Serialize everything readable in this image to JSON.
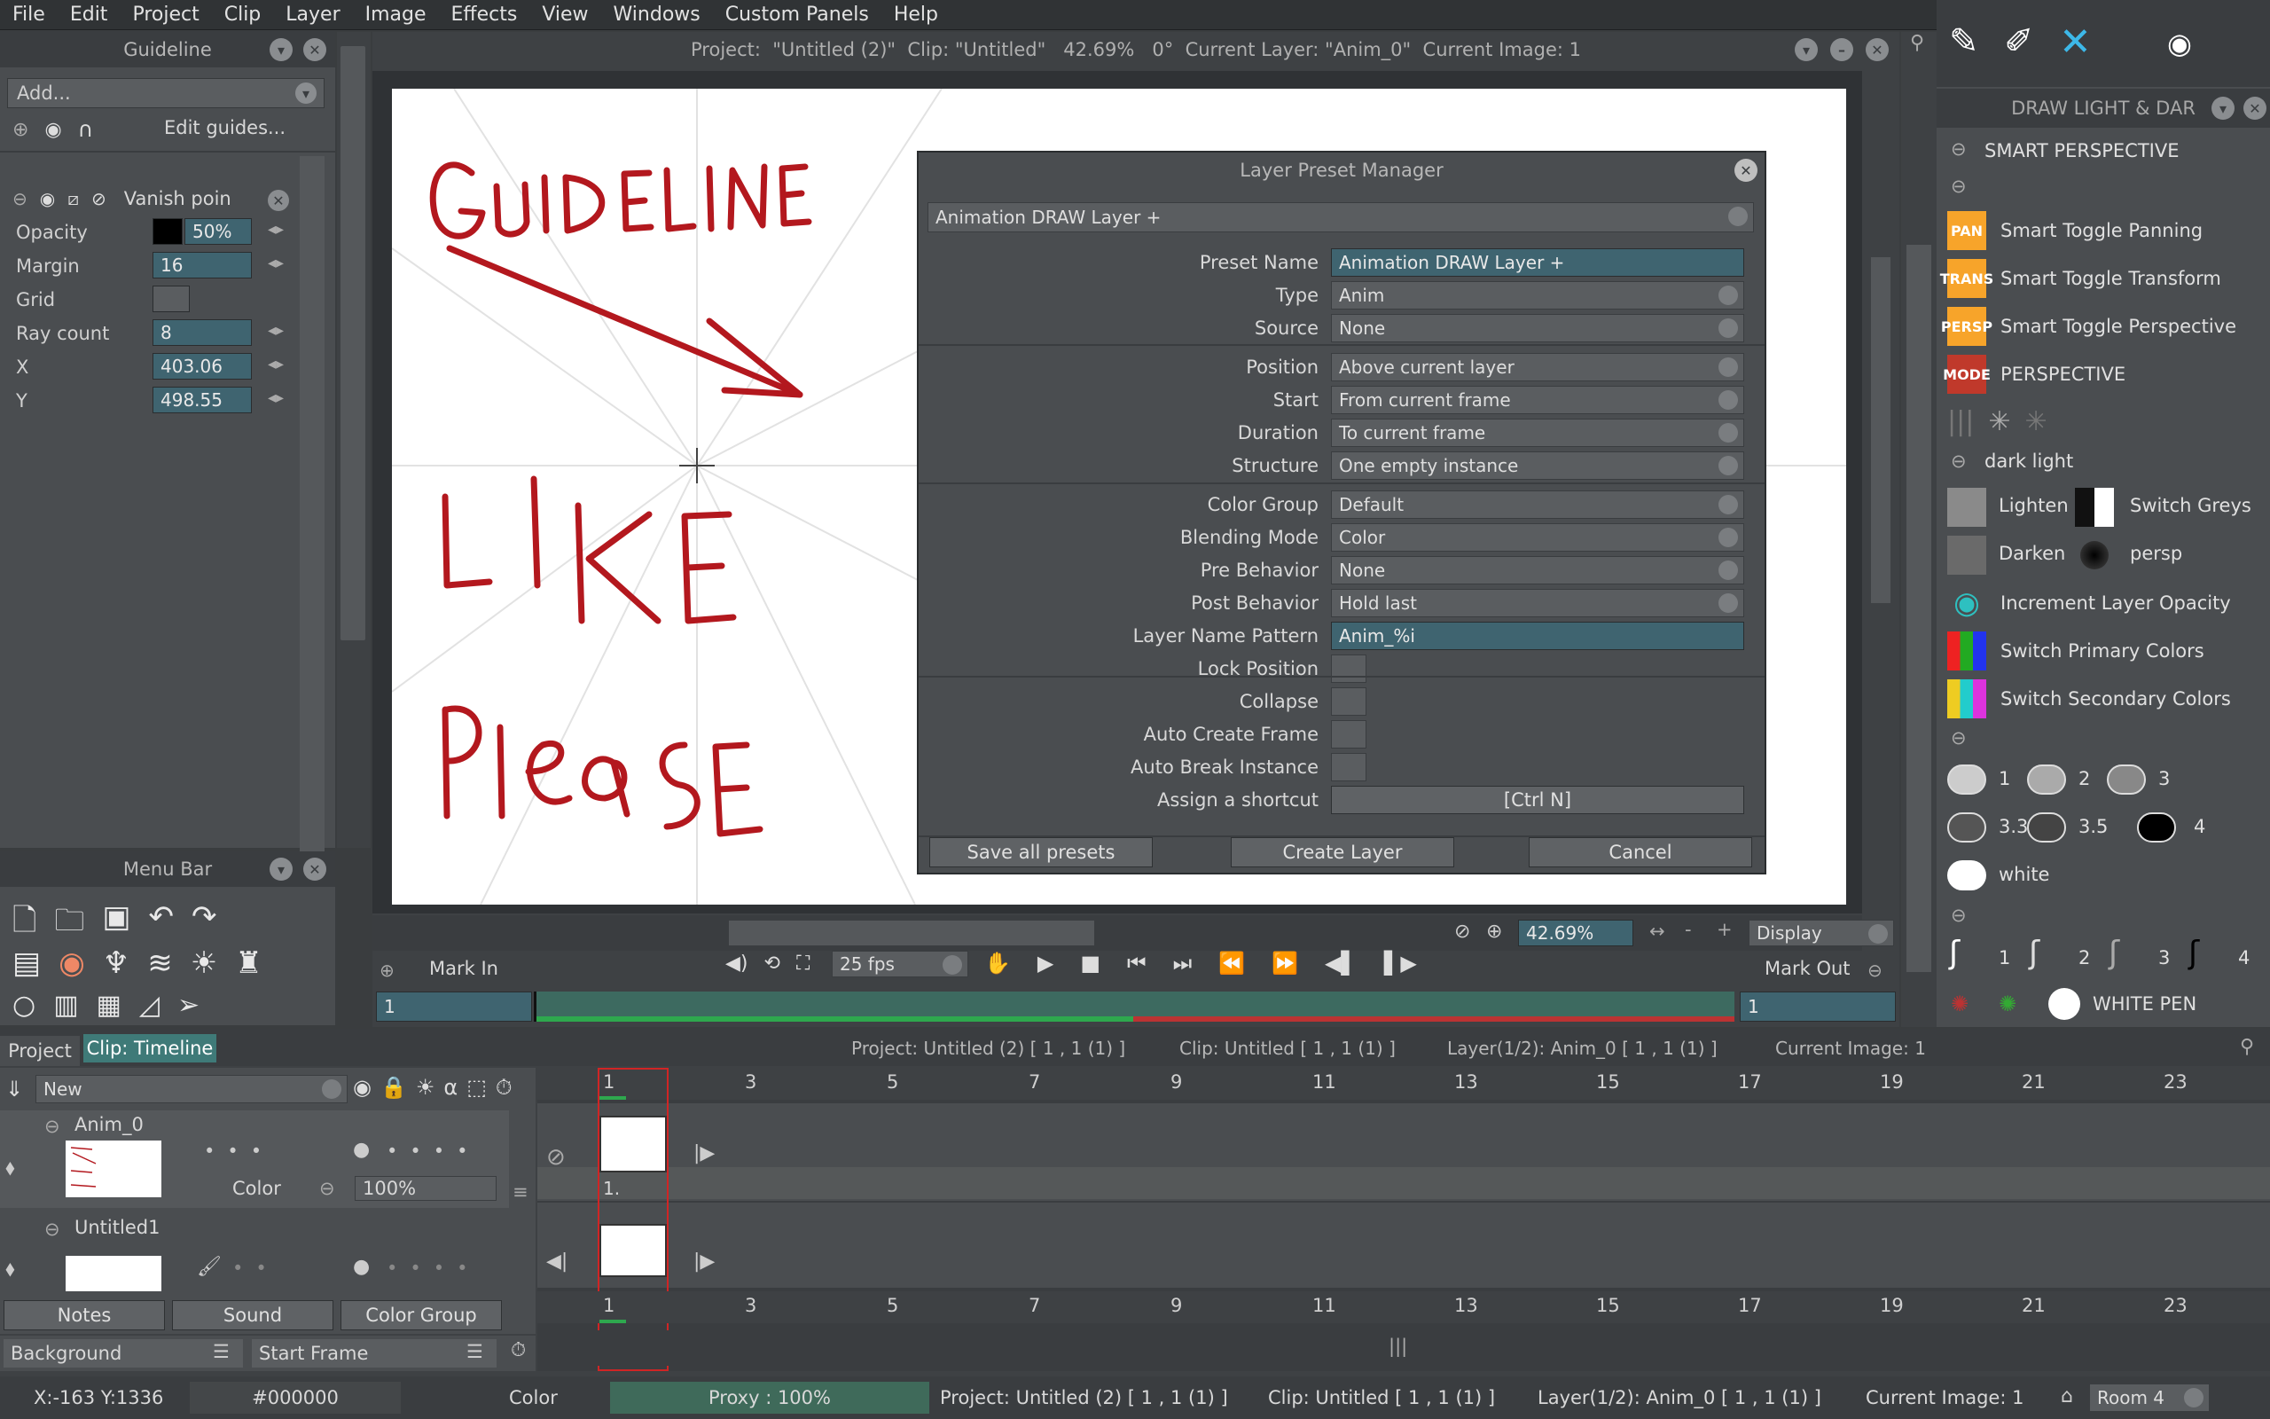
{
  "menu": [
    "File",
    "Edit",
    "Project",
    "Clip",
    "Layer",
    "Image",
    "Effects",
    "View",
    "Windows",
    "Custom Panels",
    "Help"
  ],
  "guideline_panel": {
    "title": "Guideline",
    "add_label": "Add...",
    "edit_guides": "Edit guides...",
    "vanish_label": "Vanish poin",
    "props": [
      {
        "label": "Opacity",
        "value": "50%"
      },
      {
        "label": "Margin",
        "value": "16"
      },
      {
        "label": "Grid",
        "value": ""
      },
      {
        "label": "Ray count",
        "value": "8"
      },
      {
        "label": "X",
        "value": "403.06"
      },
      {
        "label": "Y",
        "value": "498.55"
      }
    ],
    "opacity_swatch": "#000000"
  },
  "menubar_panel": {
    "title": "Menu Bar"
  },
  "viewport": {
    "title": "Project:  \"Untitled (2)\"  Clip: \"Untitled\"   42.69%   0°  Current Layer: \"Anim_0\"  Current Image: 1",
    "zoom": "42.69%",
    "display": "Display",
    "mark_in": "Mark In",
    "mark_out": "Mark Out",
    "fps": "25 fps",
    "frame_in": "1",
    "frame_out": "1"
  },
  "dialog": {
    "title": "Layer Preset Manager",
    "preset_select": "Animation DRAW  Layer +",
    "rows": [
      {
        "label": "Preset Name",
        "value": "Animation DRAW  Layer +",
        "kind": "text"
      },
      {
        "label": "Type",
        "value": "Anim",
        "kind": "dd"
      },
      {
        "label": "Source",
        "value": "None",
        "kind": "dd"
      },
      {
        "label": "Position",
        "value": "Above current layer",
        "kind": "dd"
      },
      {
        "label": "Start",
        "value": "From current frame",
        "kind": "dd"
      },
      {
        "label": "Duration",
        "value": "To current frame",
        "kind": "dd"
      },
      {
        "label": "Structure",
        "value": "One empty instance",
        "kind": "dd"
      },
      {
        "label": "Color Group",
        "value": "Default",
        "kind": "dd"
      },
      {
        "label": "Blending Mode",
        "value": "Color",
        "kind": "dd"
      },
      {
        "label": "Pre Behavior",
        "value": "None",
        "kind": "dd"
      },
      {
        "label": "Post Behavior",
        "value": "Hold last",
        "kind": "dd"
      },
      {
        "label": "Layer Name Pattern",
        "value": "Anim_%i",
        "kind": "text"
      },
      {
        "label": "Lock Position",
        "value": "",
        "kind": "chk"
      },
      {
        "label": "Collapse",
        "value": "",
        "kind": "chk"
      },
      {
        "label": "Auto Create Frame",
        "value": "",
        "kind": "chk"
      },
      {
        "label": "Auto Break Instance",
        "value": "",
        "kind": "chk"
      },
      {
        "label": "Assign a shortcut",
        "value": "[Ctrl N]",
        "kind": "btn"
      }
    ],
    "save_all": "Save all presets",
    "create": "Create Layer",
    "cancel": "Cancel"
  },
  "right_panel": {
    "title": "DRAW LIGHT & DAR",
    "smart_perspective": "SMART PERSPECTIVE",
    "items": [
      {
        "icon": "PAN",
        "label": "Smart Toggle Panning",
        "color": "#f7a42a"
      },
      {
        "icon": "TRANS",
        "label": "Smart Toggle Transform",
        "color": "#f7a42a"
      },
      {
        "icon": "PERSP",
        "label": "Smart Toggle Perspective",
        "color": "#f7a42a"
      },
      {
        "icon": "MODE",
        "label": "PERSPECTIVE",
        "color": "#c0392b"
      }
    ],
    "dark_light": "dark light",
    "lighten": "Lighten",
    "switch_greys": "Switch Greys",
    "darken": "Darken",
    "persp": "persp",
    "increment_opacity": "Increment Layer Opacity",
    "switch_primary": "Switch Primary Colors",
    "switch_secondary": "Switch Secondary Colors",
    "brush_labels": [
      "1",
      "2",
      "3",
      "3.3",
      "3.5",
      "4"
    ],
    "white": "white",
    "pen_labels": [
      "1",
      "2",
      "3",
      "4"
    ],
    "white_pen": "WHITE PEN"
  },
  "timeline": {
    "tab_project": "Project",
    "tab_clip": "Clip: Timeline",
    "info": [
      "Project: Untitled (2) [ 1 , 1  (1) ]",
      "Clip: Untitled [ 1 , 1  (1) ]",
      "Layer(1/2): Anim_0 [ 1 , 1  (1) ]",
      "Current Image: 1"
    ],
    "new_select": "New",
    "layers": [
      {
        "name": "Anim_0",
        "color_label": "Color",
        "opacity": "100%"
      },
      {
        "name": "Untitled1"
      }
    ],
    "tabs": [
      "Notes",
      "Sound",
      "Color Group"
    ],
    "background": "Background",
    "start_frame": "Start Frame",
    "ticks": [
      "1",
      "3",
      "5",
      "7",
      "9",
      "11",
      "13",
      "15",
      "17",
      "19",
      "21",
      "23"
    ],
    "cell_label": "1."
  },
  "status": {
    "coords": "X:-163  Y:1336",
    "color_hex": "#000000",
    "color": "Color",
    "proxy": "Proxy : 100%",
    "project": "Project: Untitled (2) [ 1 , 1  (1) ]",
    "clip": "Clip: Untitled [ 1 , 1  (1) ]",
    "layer": "Layer(1/2): Anim_0 [ 1 , 1  (1) ]",
    "current_image": "Current Image: 1",
    "room": "Room 4"
  },
  "colors": {
    "accent": "#3f6470",
    "ink": "#b3181e",
    "timeline_green": "#4a7a6a"
  }
}
